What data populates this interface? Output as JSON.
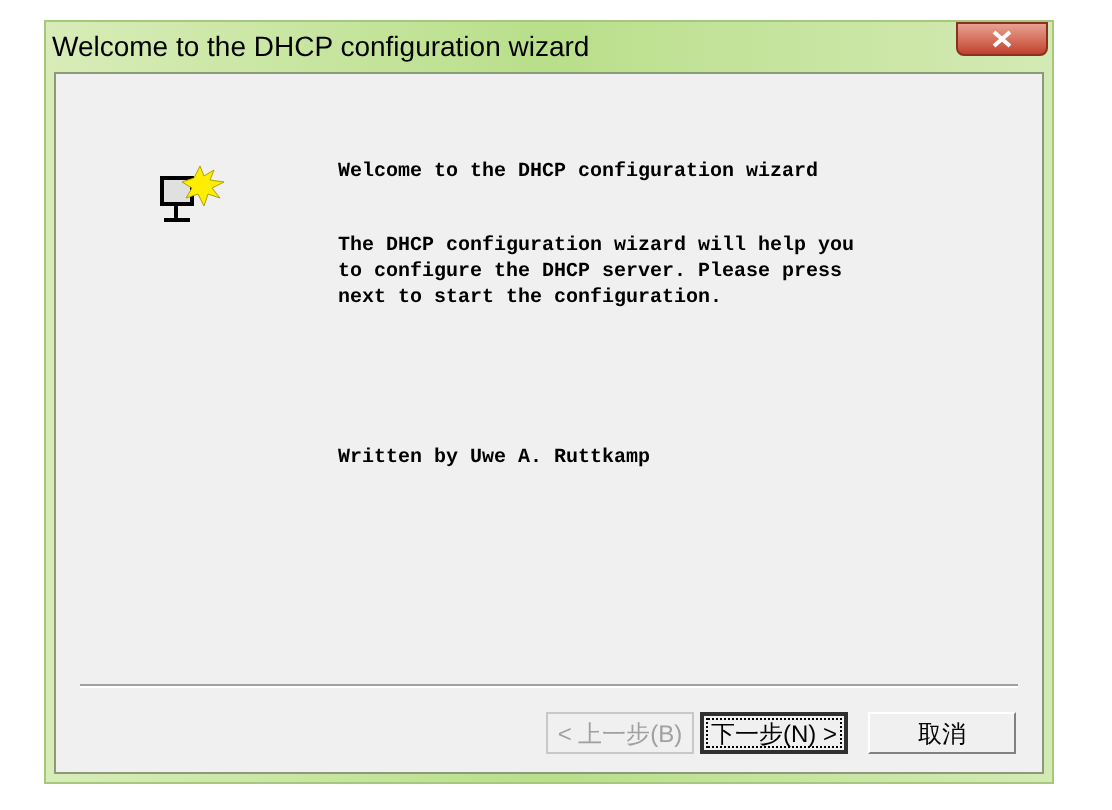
{
  "window": {
    "title": "Welcome to the DHCP configuration wizard"
  },
  "content": {
    "heading": "Welcome to the DHCP configuration wizard",
    "description": "The DHCP configuration wizard will help you to configure the DHCP server. Please press next to start the configuration.",
    "author": "Written by Uwe A. Ruttkamp"
  },
  "buttons": [
    {
      "label": "< 上一步(B)",
      "disabled": true,
      "default": false
    },
    {
      "label": "下一步(N) >",
      "disabled": false,
      "default": true
    },
    {
      "label": "取消",
      "disabled": false,
      "default": false
    }
  ]
}
